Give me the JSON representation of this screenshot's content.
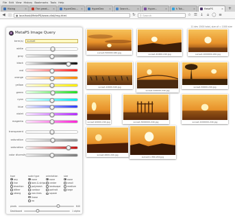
{
  "menubar": [
    "File",
    "Edit",
    "View",
    "History",
    "Bookmarks",
    "Tools",
    "Help"
  ],
  "tabs": [
    {
      "label": "Mixing",
      "icon": "blue-box-icon",
      "color": "#3a6fb5",
      "active": false
    },
    {
      "label": "The great...",
      "icon": "red-doc-icon",
      "color": "#c0392b",
      "active": false
    },
    {
      "label": "HyperDex...",
      "icon": "doc-icon",
      "color": "#4a7cc2",
      "active": false
    },
    {
      "label": "HyperDex",
      "icon": "blue-box-icon",
      "color": "#2e6db4",
      "active": false
    },
    {
      "label": "Search...",
      "icon": "grid-icon",
      "color": "#4a87c8",
      "active": false
    },
    {
      "label": "Hyper...",
      "icon": "purple-icon",
      "color": "#7a4a9e",
      "active": false
    },
    {
      "label": "A Tok...",
      "icon": "bird-icon",
      "color": "#2ea3e0",
      "active": false
    },
    {
      "label": "MetaPS",
      "icon": "logo-icon",
      "color": "#4b3468",
      "active": true
    }
  ],
  "address": {
    "url": "localhost/MetaPS/www-dist/img.html"
  },
  "search": {
    "placeholder": "Search"
  },
  "panel": {
    "title": "MetaPS Image Query",
    "terms_label": "term(s)",
    "terms_value": "sunset",
    "colors": [
      {
        "label": "white",
        "gradient": [
          "#f4f4f4",
          "#ffffff"
        ],
        "value": 0.52
      },
      {
        "label": "gray",
        "gradient": [
          "#e8e8e8",
          "#888888"
        ],
        "value": 0.5
      },
      {
        "label": "black",
        "gradient": [
          "#f2f2f2",
          "#101010"
        ],
        "value": 0.82
      },
      {
        "label": "red",
        "gradient": [
          "#ffe7e7",
          "#ff2020"
        ],
        "value": 0.5
      },
      {
        "label": "orange",
        "gradient": [
          "#fff0e0",
          "#ff8a00"
        ],
        "value": 0.5
      },
      {
        "label": "yellow",
        "gradient": [
          "#fffbe0",
          "#ffee00"
        ],
        "value": 0.5
      },
      {
        "label": "green",
        "gradient": [
          "#e8ffe8",
          "#22dd22"
        ],
        "value": 0.52
      },
      {
        "label": "cyan",
        "gradient": [
          "#e6ffff",
          "#00e8f0"
        ],
        "value": 0.5
      },
      {
        "label": "blue",
        "gradient": [
          "#e8eaff",
          "#2b3bff"
        ],
        "value": 0.5
      },
      {
        "label": "violet",
        "gradient": [
          "#f6e6ff",
          "#b42bff"
        ],
        "value": 0.5
      },
      {
        "label": "magenta",
        "gradient": [
          "#ffe6fb",
          "#ff22d8"
        ],
        "value": 0.5
      }
    ],
    "attributes": [
      {
        "label": "transparent",
        "gradient": [
          "#f4f4f4",
          "#ffffff"
        ],
        "value": 0.5
      },
      {
        "label": "saturation",
        "gradient": [
          "#f2f2f2",
          "#8e8e8e"
        ],
        "value": 0.52
      },
      {
        "label": "saturation",
        "gradient": [
          "#f2f2f2",
          "#c41010"
        ],
        "value": 0.82
      },
      {
        "label": "color diversity",
        "gradient": [
          "#eaeaea",
          "#7a7a7a"
        ],
        "value": 0.5
      }
    ],
    "option_groups": [
      {
        "heading": "type",
        "options": [
          {
            "label": "any",
            "on": true
          },
          {
            "label": "line",
            "on": false
          },
          {
            "label": "bisection",
            "on": false
          },
          {
            "label": "dither",
            "on": false
          },
          {
            "label": "strong",
            "on": false
          }
        ]
      },
      {
        "heading": "scale type",
        "options": [
          {
            "label": "none",
            "on": true
          },
          {
            "label": "bars & strips",
            "on": false
          },
          {
            "label": "polymesh",
            "on": false
          },
          {
            "label": "contour",
            "on": false
          },
          {
            "label": "non-lines",
            "on": false
          },
          {
            "label": "linear",
            "on": false
          },
          {
            "label": "no",
            "on": false
          }
        ]
      },
      {
        "heading": "orientation",
        "options": [
          {
            "label": "none",
            "on": true
          },
          {
            "label": "center",
            "on": false
          },
          {
            "label": "landscape",
            "on": false
          },
          {
            "label": "portrait",
            "on": false
          },
          {
            "label": "square",
            "on": false
          }
        ]
      },
      {
        "heading": "size",
        "options": [
          {
            "label": "none",
            "on": true
          },
          {
            "label": "small",
            "on": false
          },
          {
            "label": "medium",
            "on": false
          },
          {
            "label": "large",
            "on": false
          }
        ]
      }
    ],
    "pixels_label": "pixels",
    "pixels_end": "640",
    "pixels_value": 0.72,
    "dash_label": "Dashboard",
    "dash_end": "1 alpha",
    "dash_value": 0.3
  },
  "results": {
    "status": "11 dev 1500 total, size of = 1000 size",
    "thumbs": [
      {
        "caption": "sunset-500000-940.jpg",
        "palette": [
          "#f6c25a",
          "#e8922a",
          "#7a3a12"
        ],
        "scene": "clouds"
      },
      {
        "caption": "sunset-40460-240.jpg",
        "palette": [
          "#ffe27a",
          "#f7a12d",
          "#3e1e08"
        ],
        "scene": "island"
      },
      {
        "caption": "sunset-1000000-240.jpg",
        "palette": [
          "#ffd46a",
          "#f5a623",
          "#5b3010"
        ],
        "scene": "sky"
      },
      {
        "caption": "sunset-10000-940.jpg",
        "palette": [
          "#fbd67a",
          "#e99a3a",
          "#3a2410"
        ],
        "scene": "birds"
      },
      {
        "caption": "sunset-100000-240.jpg",
        "palette": [
          "#f8c769",
          "#e0892e",
          "#4a2a10"
        ],
        "scene": "bridge"
      },
      {
        "caption": "sunset-30000-240.jpg",
        "palette": [
          "#e5b84a",
          "#c7801e",
          "#3a2208"
        ],
        "scene": "tree"
      },
      {
        "caption": "sunset-90000-240.jpg",
        "palette": [
          "#ffc24a",
          "#f08a12",
          "#5a2808"
        ],
        "scene": "silhouette"
      },
      {
        "caption": "sunset-3000000-240.jpg",
        "palette": [
          "#f7b43e",
          "#dd7a18",
          "#4a2408"
        ],
        "scene": "pier"
      },
      {
        "caption": "sunset-1000000-240.jpg",
        "palette": [
          "#ffb048",
          "#ec7a1a",
          "#5a2a08"
        ],
        "scene": "sea"
      },
      {
        "caption": "sunset-2600-240.jpg",
        "palette": [
          "#f8a23c",
          "#d8621a",
          "#4a1e08"
        ],
        "scene": "shore"
      },
      {
        "caption": "sunset-1-360-240.jpg",
        "palette": [
          "#ffd15a",
          "#f28a1e",
          "#3a1a06"
        ],
        "scene": "burst"
      }
    ]
  }
}
